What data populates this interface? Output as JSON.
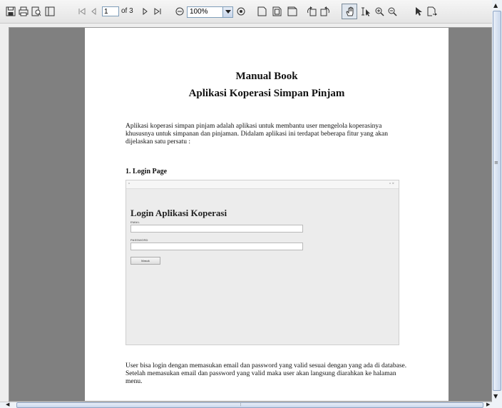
{
  "toolbar": {
    "page_number": "1",
    "page_of": "of 3",
    "zoom_value": "100%",
    "icons": [
      "save-icon",
      "print-icon",
      "print-preview-icon",
      "single-page-icon",
      "first-page-icon",
      "previous-page-icon",
      "next-page-icon",
      "last-page-icon",
      "zoom-out-icon",
      "zoom-in-icon",
      "actual-size-icon",
      "fit-page-icon",
      "fit-width-icon",
      "rotate-left-icon",
      "rotate-right-icon",
      "hand-tool-icon",
      "text-select-icon",
      "zoom-tool-icon",
      "zoom-tool-minus-icon",
      "pointer-icon",
      "export-icon"
    ]
  },
  "document": {
    "title": "Manual Book",
    "subtitle": "Aplikasi Koperasi Simpan Pinjam",
    "intro": "Aplikasi koperasi simpan pinjam adalah aplikasi untuk membantu user mengelola koperasinya khususnya untuk simpanan dan pinjaman. Didalam aplikasi ini terdapat beberapa fitur yang akan dijelaskan satu persatu :",
    "section_1": "1.   Login Page",
    "screenshot": {
      "window_controls": "▫  ×",
      "title": "Login Aplikasi Koperasi",
      "email_label": "EMAIL",
      "password_label": "PASSWORD",
      "button_label": "Masuk"
    },
    "outro": "User bisa login dengan memasukan email dan password yang valid sesuai dengan yang ada di database. Setelah memasukan email dan password yang valid maka user akan langsung diarahkan ke halaman menu."
  },
  "scroll": {
    "horizontal_grip": "⦙",
    "vertical_grip": "≡"
  }
}
